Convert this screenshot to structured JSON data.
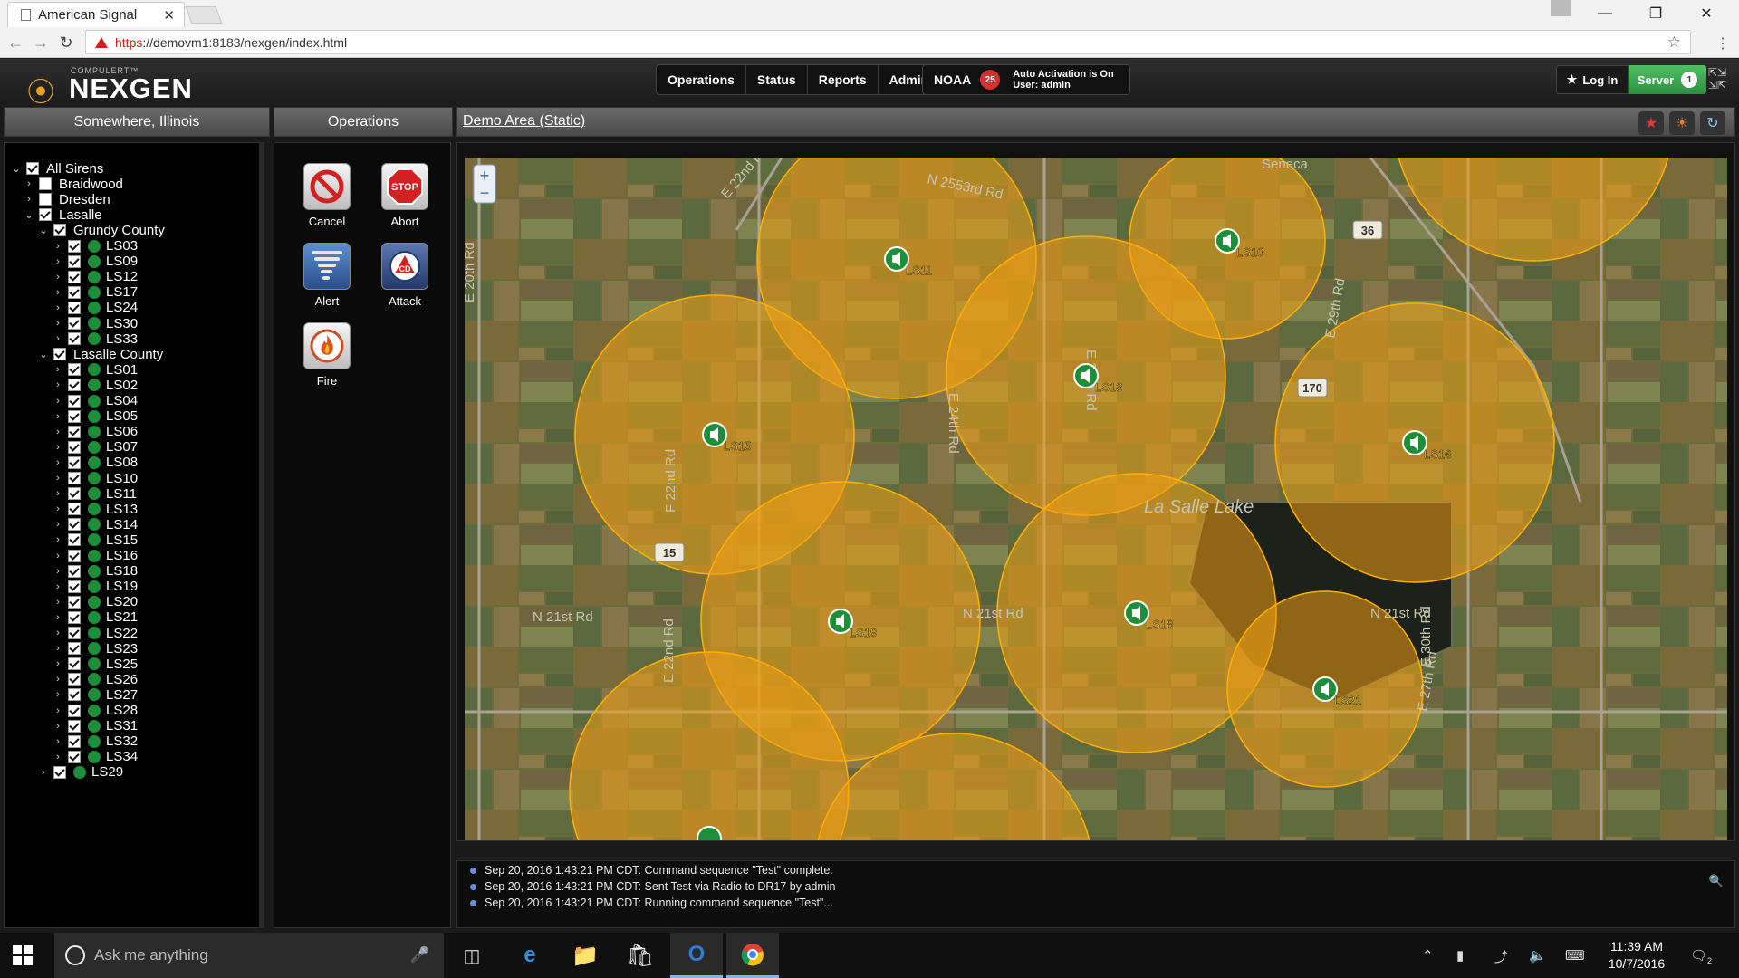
{
  "browser": {
    "tab_title": "American Signal",
    "tab_close": "✕",
    "url_proto": "https",
    "url_rest": "://demovm1:8183/nexgen/index.html"
  },
  "app": {
    "brand_small": "COMPULERT™",
    "brand_big": "NEXGEN",
    "nav": [
      "Operations",
      "Status",
      "Reports",
      "Admin"
    ],
    "noaa_label": "NOAA",
    "noaa_count": "25",
    "auto_line1": "Auto Activation is On",
    "auto_line2": "User: admin",
    "login_label": "Log In",
    "server_label": "Server",
    "server_count": "1"
  },
  "panels": {
    "location": "Somewhere, Illinois",
    "operations": "Operations",
    "map_title": "Demo Area (Static)"
  },
  "tree": {
    "root": "All Sirens",
    "groups": [
      "Braidwood",
      "Dresden"
    ],
    "lasalle": "Lasalle",
    "grundy": "Grundy County",
    "grundy_sirens": [
      "LS03",
      "LS09",
      "LS12",
      "LS17",
      "LS24",
      "LS30",
      "LS33"
    ],
    "lasalle_county": "Lasalle County",
    "lasalle_sirens": [
      "LS01",
      "LS02",
      "LS04",
      "LS05",
      "LS06",
      "LS07",
      "LS08",
      "LS10",
      "LS11",
      "LS13",
      "LS14",
      "LS15",
      "LS16",
      "LS18",
      "LS19",
      "LS20",
      "LS21",
      "LS22",
      "LS23",
      "LS25",
      "LS26",
      "LS27",
      "LS28",
      "LS31",
      "LS32",
      "LS34"
    ],
    "extra": "LS29"
  },
  "operations": [
    {
      "label": "Cancel",
      "icon": "cancel-icon"
    },
    {
      "label": "Abort",
      "icon": "stop-icon"
    },
    {
      "label": "Alert",
      "icon": "tornado-icon"
    },
    {
      "label": "Attack",
      "icon": "civil-defense-icon"
    },
    {
      "label": "Fire",
      "icon": "fire-icon"
    }
  ],
  "map": {
    "sirens": [
      {
        "id": "LS11"
      },
      {
        "id": "LS10"
      },
      {
        "id": "LS13"
      },
      {
        "id": "LS15"
      },
      {
        "id": "LS16"
      },
      {
        "id": "LS19"
      },
      {
        "id": "LS18"
      },
      {
        "id": "LS21"
      }
    ],
    "roads": [
      "N 2553rd Rd",
      "E 22nd Rd",
      "E 20th Rd",
      "F 22nd Rd",
      "N 21st Rd",
      "N 21st Rd",
      "N 21st Rd",
      "E 22nd Rd",
      "E 29th Rd",
      "E 30th Rd",
      "E 23rd Rd",
      "E 24th Rd",
      "E 27th Rd"
    ],
    "route_shields": [
      "15",
      "170",
      "36"
    ],
    "lake": "La Salle Lake",
    "partial_label": "Seneca",
    "zoom_in": "+",
    "zoom_out": "−"
  },
  "log": [
    "Sep 20, 2016 1:43:21 PM CDT: Command sequence \"Test\" complete.",
    "Sep 20, 2016 1:43:21 PM CDT: Sent Test via Radio to DR17 by admin",
    "Sep 20, 2016 1:43:21 PM CDT: Running command sequence \"Test\"..."
  ],
  "taskbar": {
    "search_placeholder": "Ask me anything",
    "time": "11:39 AM",
    "date": "10/7/2016",
    "notif_count": "2"
  },
  "colors": {
    "siren_green": "#1d8f3b",
    "coverage": "#f0a014",
    "server_green": "#3aa34e",
    "noaa_red": "#d63030"
  }
}
